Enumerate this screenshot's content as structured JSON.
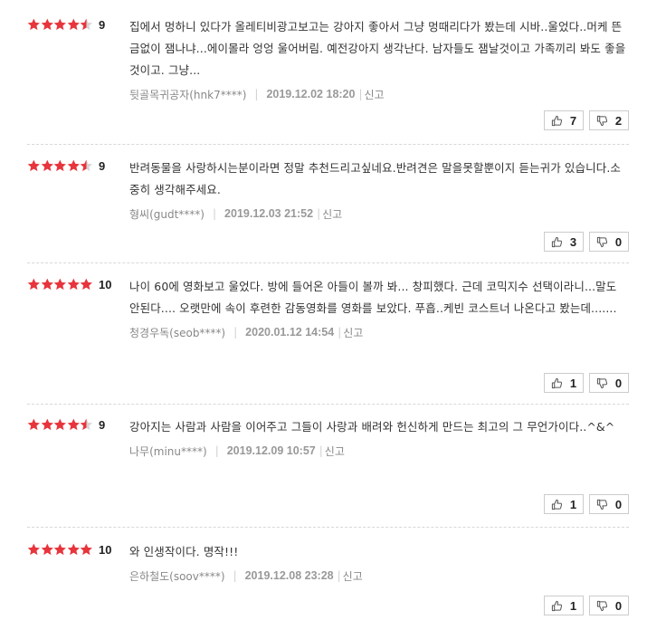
{
  "colors": {
    "star": "#e8343c",
    "star_empty": "#d5d5d5"
  },
  "reviews": [
    {
      "stars": 4.5,
      "score": "9",
      "text": "집에서 멍하니 있다가 올레티비광고보고는 강아지 좋아서 그냥 멍때리다가 봤는데 시바..울었다..머케 뜬금없이 잼나냐...에이몰라 엉엉 울어버림. 예전강아지 생각난다. 남자들도 잼날것이고 가족끼리 봐도 좋을것이고. 그냥...",
      "author": "뒷골목귀공자(hnk7****)",
      "date": "2019.12.02 18:20",
      "report": "신고",
      "likes": "7",
      "dislikes": "2"
    },
    {
      "stars": 4.5,
      "score": "9",
      "text": "반려동물을 사랑하시는분이라면 정말 추천드리고싶네요.반려견은 말을못할뿐이지 듣는귀가 있습니다.소중히 생각해주세요.",
      "author": "형씨(gudt****)",
      "date": "2019.12.03 21:52",
      "report": "신고",
      "likes": "3",
      "dislikes": "0"
    },
    {
      "stars": 5,
      "score": "10",
      "text": "나이 60에 영화보고 울었다. 방에 들어온 아들이 볼까 봐... 창피했다. 근데 코믹지수 선택이라니...말도 안된다.... 오랫만에 속이 후련한 감동영화를 영화를 보았다. 푸흡..케빈 코스트너 나온다고 봤는데.......",
      "author": "청경우독(seob****)",
      "date": "2020.01.12 14:54",
      "report": "신고",
      "likes": "1",
      "dislikes": "0"
    },
    {
      "stars": 4.5,
      "score": "9",
      "text": "강아지는 사람과 사람을 이어주고 그들이 사랑과 배려와 헌신하게 만드는 최고의 그 무언가이다..^&^",
      "author": "나무(minu****)",
      "date": "2019.12.09 10:57",
      "report": "신고",
      "likes": "1",
      "dislikes": "0"
    },
    {
      "stars": 5,
      "score": "10",
      "text": "와 인생작이다. 명작!!!",
      "author": "은하철도(soov****)",
      "date": "2019.12.08 23:28",
      "report": "신고",
      "likes": "1",
      "dislikes": "0"
    }
  ]
}
